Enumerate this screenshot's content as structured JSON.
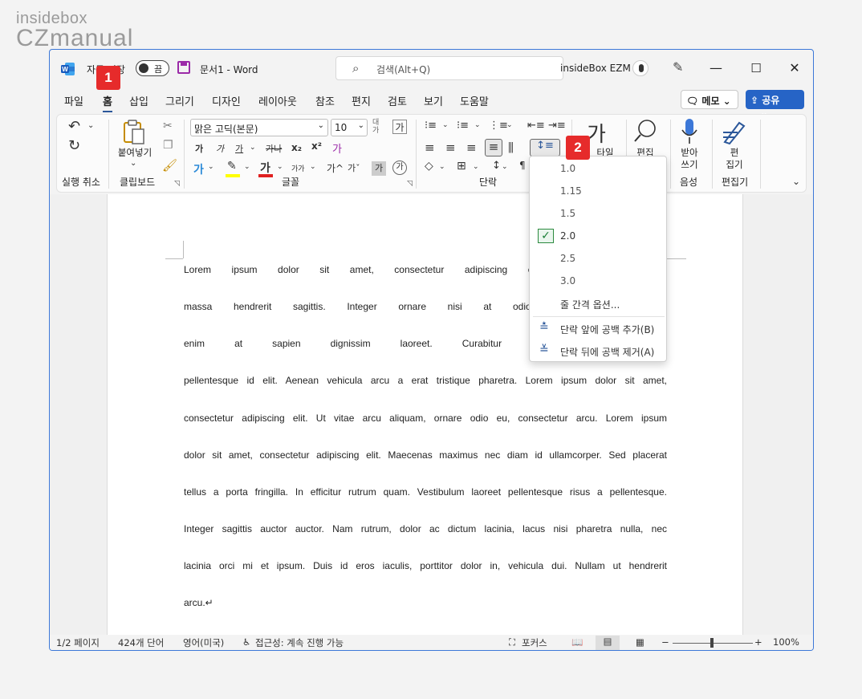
{
  "watermark": {
    "line1": "insidebox",
    "line2": "CZmanual"
  },
  "titlebar": {
    "autosave_label": "자동 저장",
    "autosave_state": "끔",
    "doc_title": "문서1  -  Word",
    "search_placeholder": "검색(Alt+Q)",
    "user_name": "insideBox EZM",
    "minimize": "—",
    "maximize": "☐",
    "close": "✕"
  },
  "tabs": [
    "파일",
    "홈",
    "삽입",
    "그리기",
    "디자인",
    "레이아웃",
    "참조",
    "편지",
    "검토",
    "보기",
    "도움말"
  ],
  "memo_label": "메모 ⌄",
  "share_label": "공유",
  "badges": {
    "one": "1",
    "two": "2"
  },
  "ribbon": {
    "undo_label": "실행 취소",
    "paste_label": "붙여넣기",
    "clipboard_label": "클립보드",
    "font_name": "맑은 고딕(본문)",
    "font_size": "10",
    "font_group_label": "글꼴",
    "paragraph_label": "단락",
    "style_label": "타일",
    "edit_label": "편집",
    "dictate_label": "받아\n쓰기",
    "voice_label": "음성",
    "editor_label": "편\n집기",
    "editor_group_label": "편집기"
  },
  "document": {
    "lines": [
      "Lorem ipsum dolor sit amet, consectetur adipiscing elit. Sed suscipit ma",
      "massa hendrerit sagittis. Integer ornare nisi at odio mattis, quis conse",
      "enim at sapien dignissim laoreet. Curabitur mauris libero, cong",
      "pellentesque id elit. Aenean vehicula arcu a erat tristique pharetra. Lorem ipsum dolor sit amet,",
      "consectetur adipiscing elit. Ut vitae arcu aliquam, ornare odio eu, consectetur arcu. Lorem ipsum",
      "dolor sit amet, consectetur adipiscing elit. Maecenas maximus nec diam id ullamcorper. Sed placerat",
      "tellus a porta fringilla. In efficitur rutrum quam. Vestibulum laoreet pellentesque risus a pellentesque.",
      "Integer sagittis auctor auctor. Nam rutrum, dolor ac dictum lacinia, lacus nisi pharetra nulla, nec",
      "lacinia orci mi et ipsum. Duis id eros iaculis, porttitor dolor in, vehicula dui. Nullam ut hendrerit",
      "arcu.↵"
    ]
  },
  "line_spacing_menu": {
    "options": [
      "1.0",
      "1.15",
      "1.5",
      "2.0",
      "2.5",
      "3.0"
    ],
    "selected": "2.0",
    "more_options": "줄 간격 옵션...",
    "add_space_before": "단락 앞에 공백 추가(B)",
    "remove_space_after": "단락 뒤에 공백 제거(A)"
  },
  "statusbar": {
    "page": "1/2 페이지",
    "words": "424개 단어",
    "language": "영어(미국)",
    "accessibility": "접근성: 계속 진행 가능",
    "focus": "포커스",
    "zoom_minus": "−",
    "zoom_plus": "+",
    "zoom": "100%"
  },
  "colors": {
    "accent": "#2b579a",
    "share": "#2664c6",
    "badge": "#e62b2b",
    "check": "#1a7f37"
  }
}
